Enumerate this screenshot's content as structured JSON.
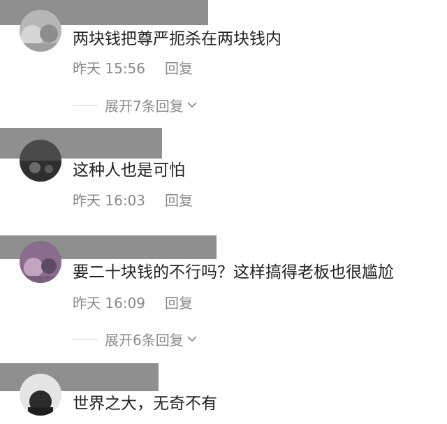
{
  "comments": [
    {
      "text": "两块钱把尊严扼杀在两块钱内",
      "time": "昨天 15:56",
      "reply_label": "回复",
      "expand_label": "展开7条回复"
    },
    {
      "text": "这种人也是可怕",
      "time": "昨天 16:03",
      "reply_label": "回复"
    },
    {
      "text": "要二十块钱的不行吗？这样搞得老板也很尴尬",
      "time": "昨天 16:09",
      "reply_label": "回复",
      "expand_label": "展开6条回复"
    },
    {
      "text": "世界之大，无奇不有"
    }
  ],
  "icons": {
    "expand": "chevron-down-icon"
  },
  "colors": {
    "text": "#222222",
    "meta": "#8a8a8a",
    "redaction": "#8f8f8f"
  }
}
